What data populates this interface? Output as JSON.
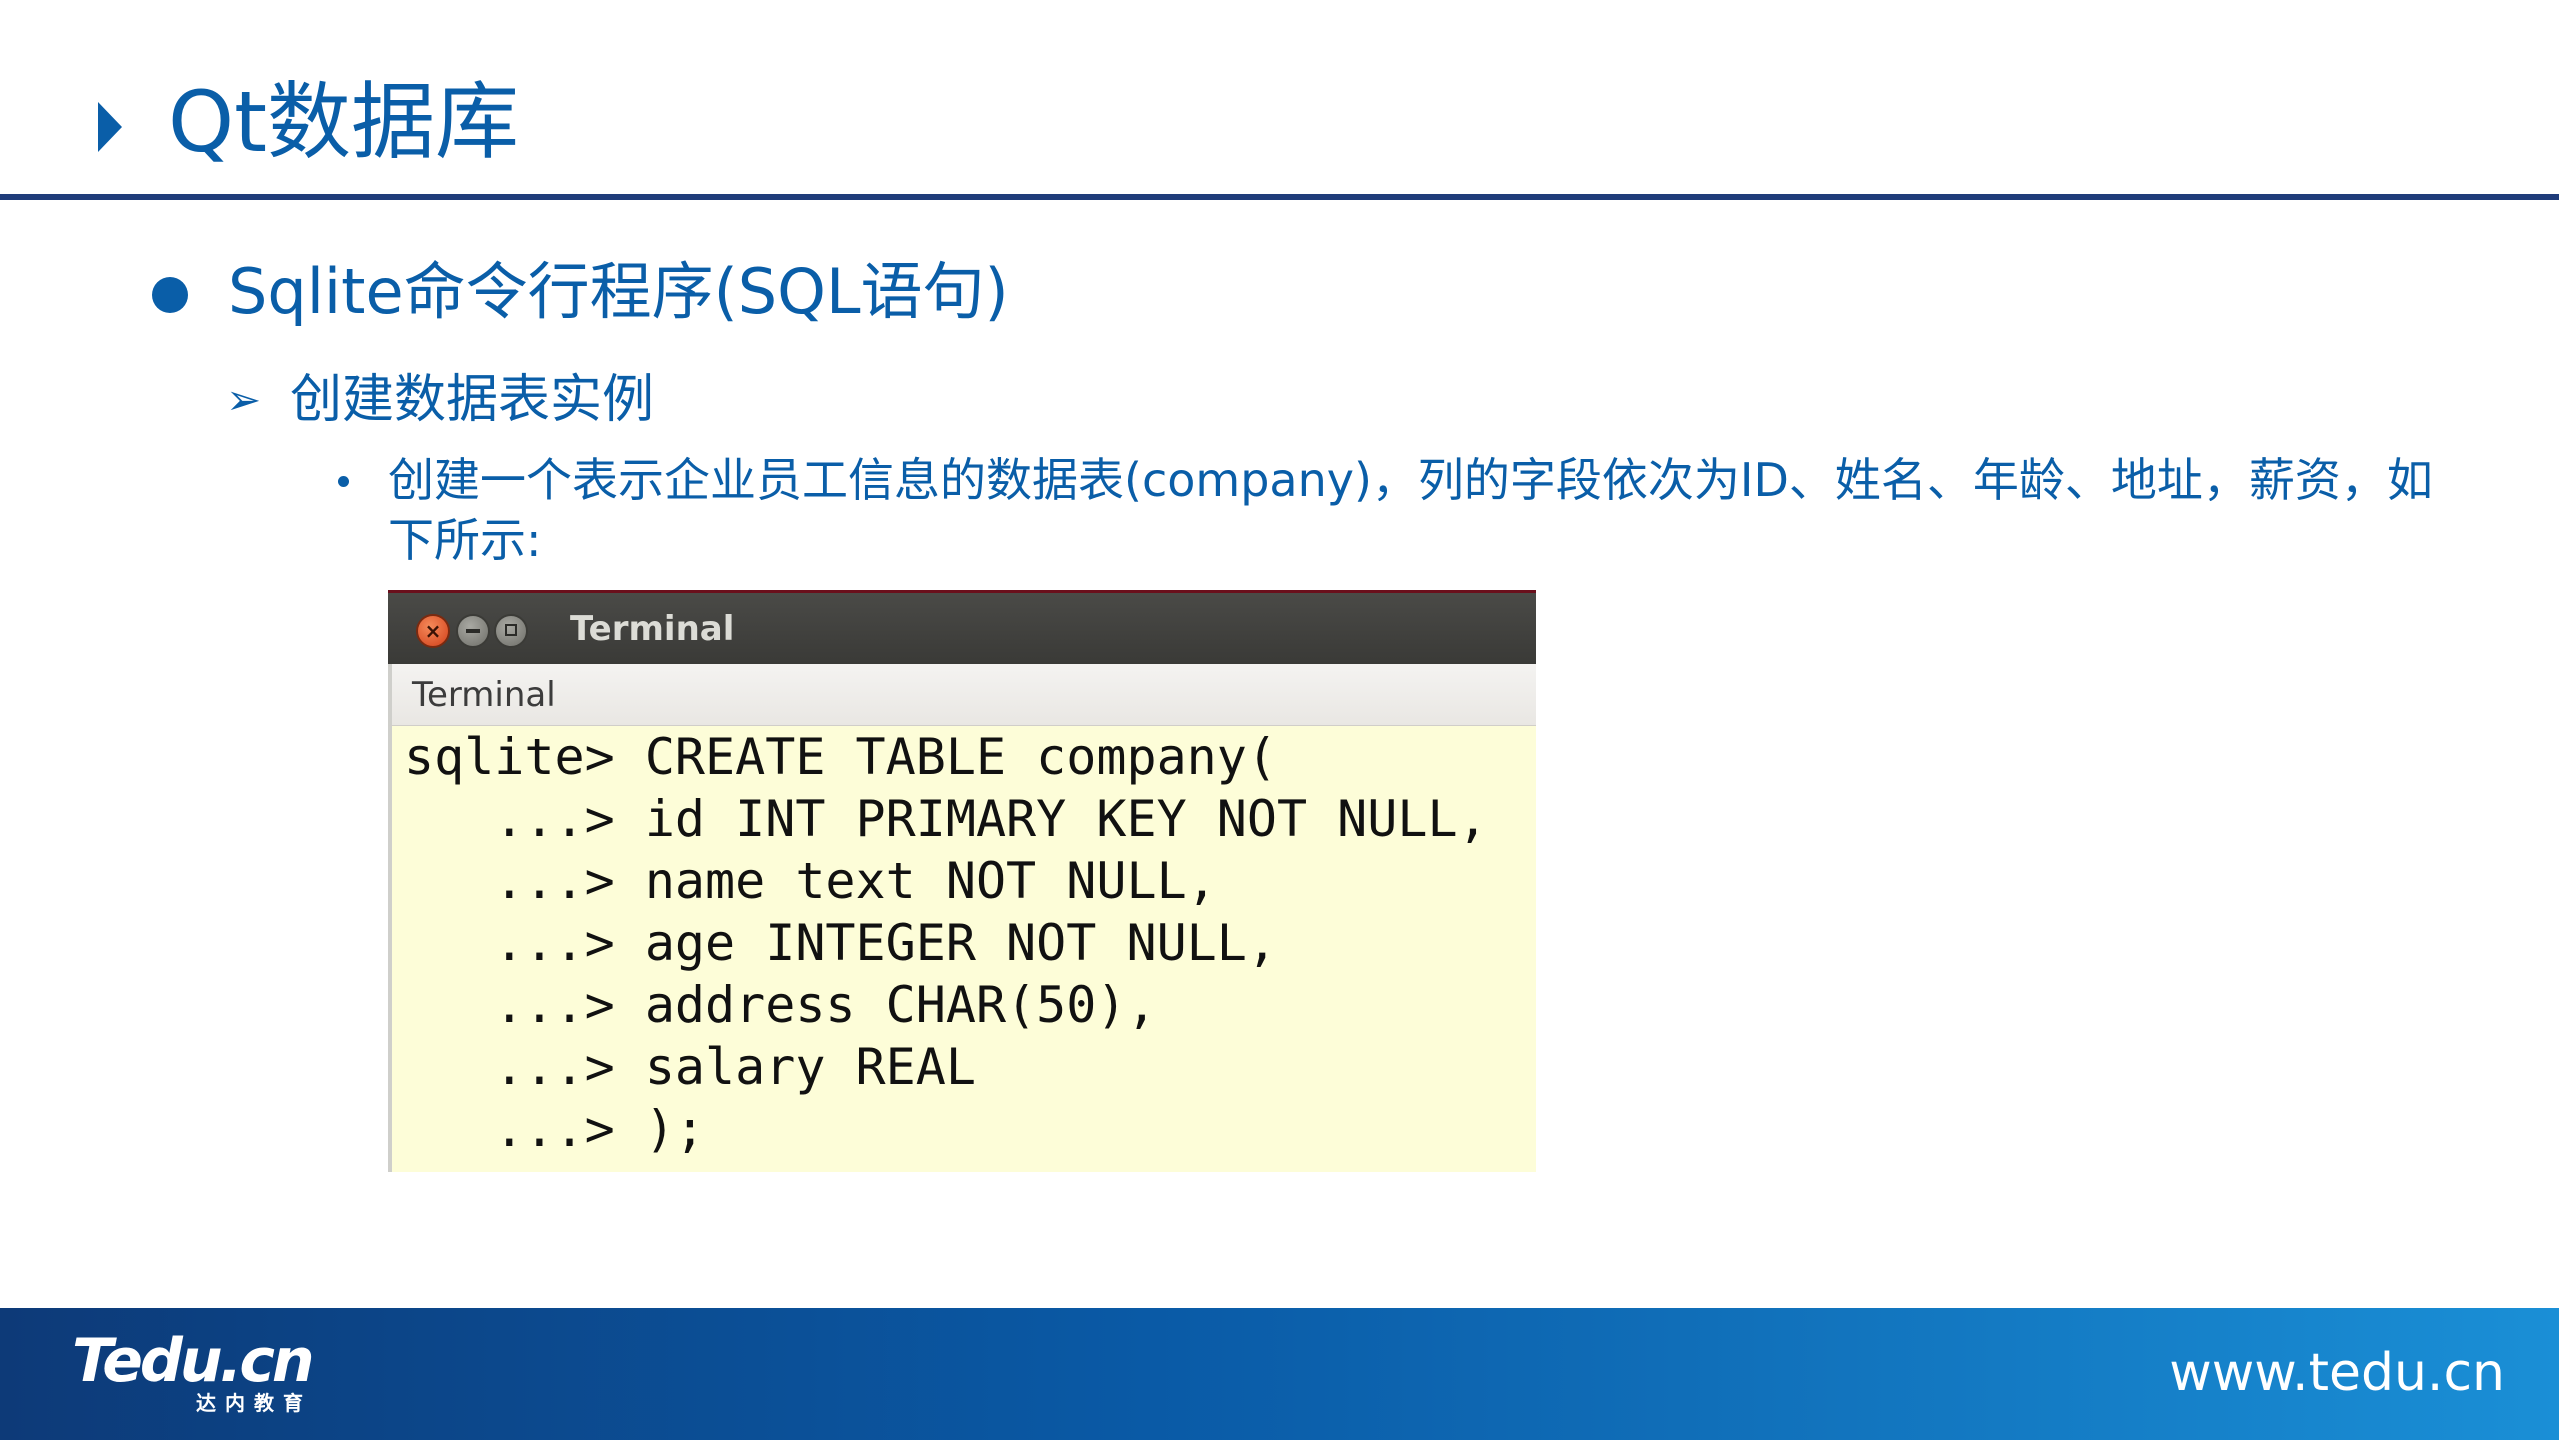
{
  "slide": {
    "title": "Qt数据库",
    "bullet_level1": "Sqlite命令行程序(SQL语句)",
    "bullet_level2": "创建数据表实例",
    "bullet_level3": "创建一个表示企业员工信息的数据表(company)，列的字段依次为ID、姓名、年龄、地址，薪资，如下所示:"
  },
  "terminal": {
    "window_title": "Terminal",
    "menu_label": "Terminal",
    "close_glyph": "×",
    "lines": [
      "sqlite> CREATE TABLE company(",
      "   ...> id INT PRIMARY KEY NOT NULL,",
      "   ...> name text NOT NULL,",
      "   ...> age INTEGER NOT NULL,",
      "   ...> address CHAR(50),",
      "   ...> salary REAL",
      "   ...> );"
    ]
  },
  "footer": {
    "logo_text": "Tedu.cn",
    "logo_subtext": "达内教育",
    "url": "www.tedu.cn"
  },
  "colors": {
    "accent_blue": "#0a5ea8",
    "rule_navy": "#1f3c7a",
    "terminal_bg": "#fdfdd8"
  }
}
